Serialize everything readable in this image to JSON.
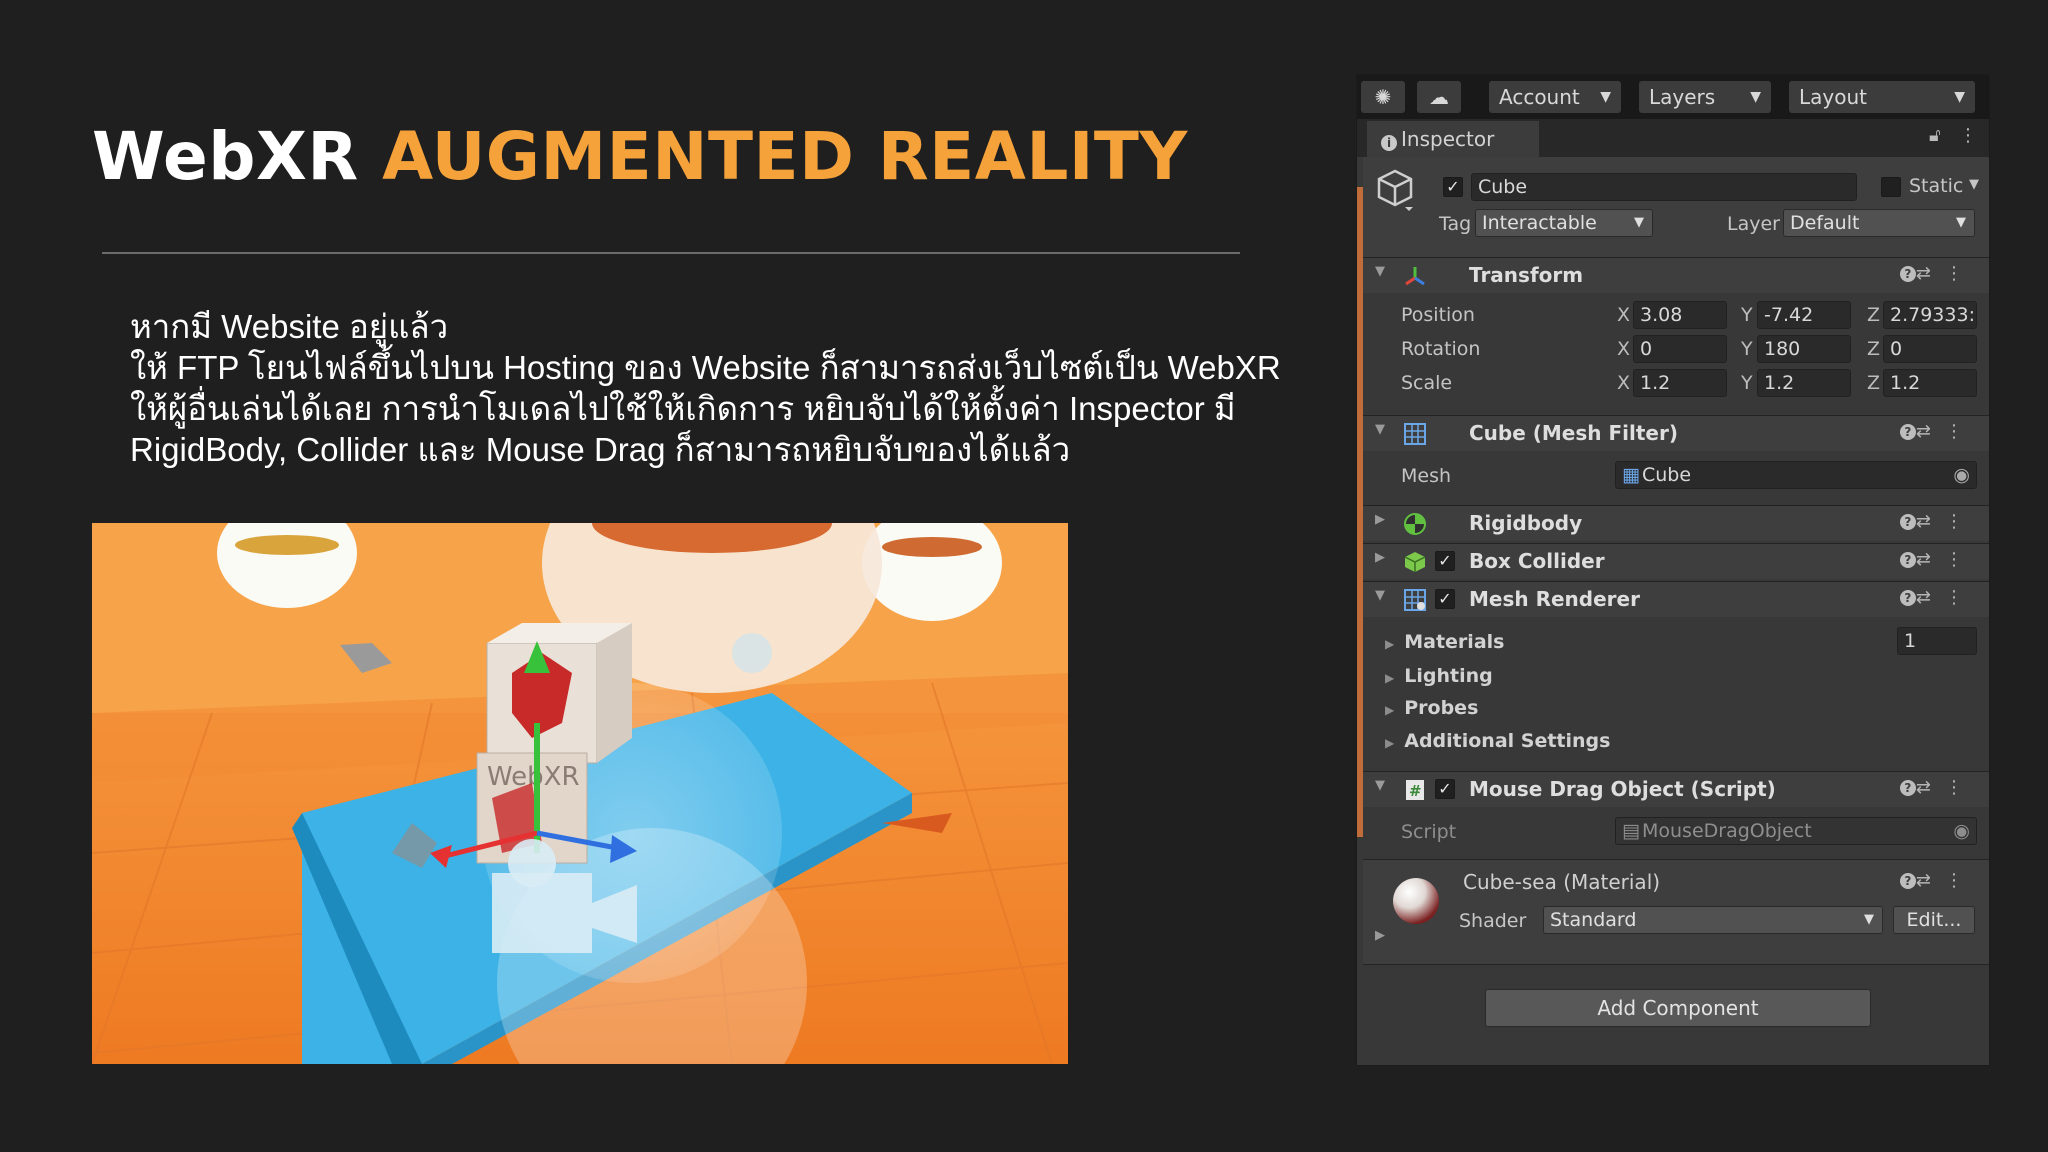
{
  "slide": {
    "title_white": "WebXR",
    "title_orange": "AUGMENTED REALITY",
    "lines": [
      "หากมี Website อยู่แล้ว",
      "ให้ FTP โยนไฟล์ขึ้นไปบน Hosting ของ Website ก็สามารถส่งเว็บไซต์เป็น WebXR",
      "ให้ผู้อื่นเล่นได้เลย การนำโมเดลไปใช้ให้เกิดการ หยิบจับได้ให้ตั้งค่า Inspector มี",
      "RigidBody, Collider และ Mouse Drag ก็สามารถหยิบจับของได้แล้ว"
    ],
    "scene_label": "WebXR"
  },
  "toolbar": {
    "account": "Account",
    "layers": "Layers",
    "layout": "Layout"
  },
  "inspector": {
    "tab_label": "Inspector",
    "object_name": "Cube",
    "static_label": "Static",
    "tag_label": "Tag",
    "tag_value": "Interactable",
    "layer_label": "Layer",
    "layer_value": "Default"
  },
  "transform": {
    "title": "Transform",
    "rows": [
      {
        "label": "Position",
        "x": "3.08",
        "y": "-7.42",
        "z": "2.79333:"
      },
      {
        "label": "Rotation",
        "x": "0",
        "y": "180",
        "z": "0"
      },
      {
        "label": "Scale",
        "x": "1.2",
        "y": "1.2",
        "z": "1.2"
      }
    ]
  },
  "mesh_filter": {
    "title": "Cube (Mesh Filter)",
    "mesh_label": "Mesh",
    "mesh_value": "Cube"
  },
  "rigidbody": {
    "title": "Rigidbody"
  },
  "box_collider": {
    "title": "Box Collider"
  },
  "mesh_renderer": {
    "title": "Mesh Renderer",
    "materials": "Materials",
    "materials_count": "1",
    "lighting": "Lighting",
    "probes": "Probes",
    "additional": "Additional Settings"
  },
  "mouse_drag": {
    "title": "Mouse Drag Object (Script)",
    "script_label": "Script",
    "script_value": "MouseDragObject"
  },
  "material": {
    "name": "Cube-sea (Material)",
    "shader_label": "Shader",
    "shader_value": "Standard",
    "edit_label": "Edit..."
  },
  "add_component": "Add Component",
  "colors": {
    "accent_orange": "#f5a23b",
    "unity_bg": "#383838",
    "header_bg": "#3e3e3e"
  }
}
